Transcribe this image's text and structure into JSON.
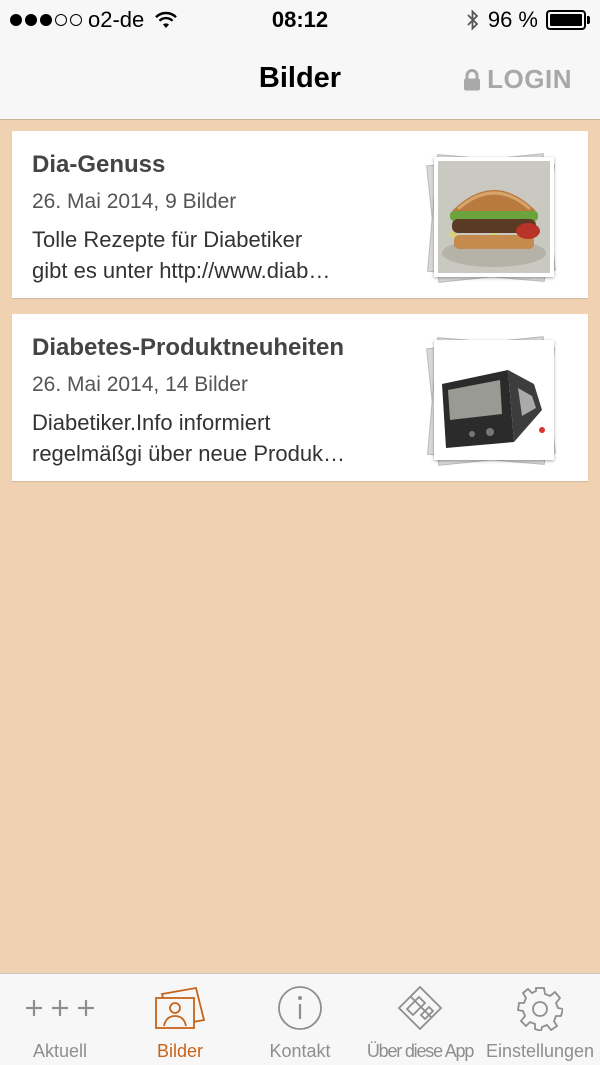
{
  "status_bar": {
    "carrier": "o2-de",
    "time": "08:12",
    "battery": "96 %",
    "signal_bars_filled": 3,
    "signal_bars_total": 5
  },
  "nav": {
    "title": "Bilder",
    "login_label": "LOGIN"
  },
  "galleries": [
    {
      "title": "Dia-Genuss",
      "meta": "26. Mai 2014, 9 Bilder",
      "desc_line1": "Tolle Rezepte für Diabetiker",
      "desc_line2": "gibt es unter http://www.diab…",
      "thumb_icon": "burger-photo-icon"
    },
    {
      "title": "Diabetes-Produktneuheiten",
      "meta": "26. Mai 2014, 14 Bilder",
      "desc_line1": "Diabetiker.Info informiert",
      "desc_line2": "regelmäßgi über neue Produk…",
      "thumb_icon": "glucose-meter-photo-icon"
    }
  ],
  "tabs": [
    {
      "label": "Aktuell",
      "icon": "plus-plus-plus-icon",
      "active": false
    },
    {
      "label": "Bilder",
      "icon": "photos-icon",
      "active": true
    },
    {
      "label": "Kontakt",
      "icon": "info-icon",
      "active": false
    },
    {
      "label": "Über diese App",
      "icon": "app-icon",
      "active": false
    },
    {
      "label": "Einstellungen",
      "icon": "gear-icon",
      "active": false
    }
  ],
  "colors": {
    "background": "#f0d2b2",
    "active_tab": "#c8641a",
    "inactive_tab": "#8e8e8e",
    "login": "#a8a8a8"
  }
}
